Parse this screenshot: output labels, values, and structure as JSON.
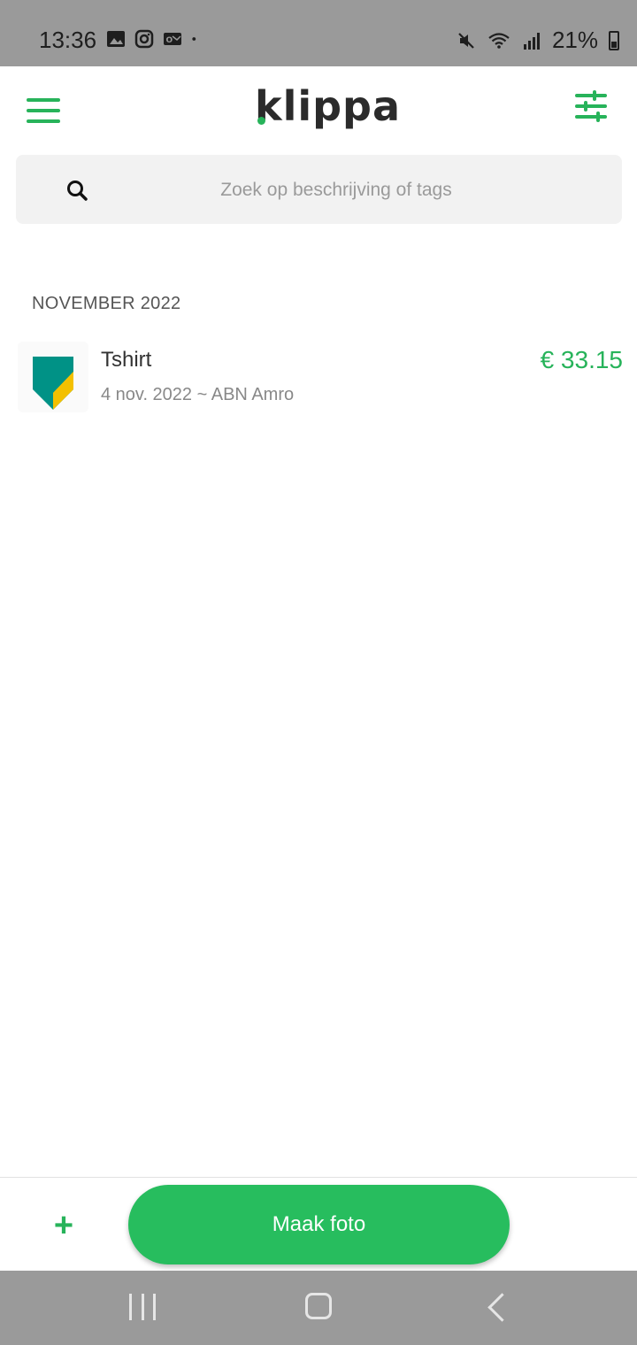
{
  "status_bar": {
    "time": "13:36",
    "battery": "21%",
    "left_icons": [
      "gallery-icon",
      "instagram-icon",
      "outlook-icon",
      "dot-icon"
    ],
    "right_icons": [
      "mute-icon",
      "wifi-icon",
      "signal-icon",
      "battery-icon"
    ]
  },
  "app_bar": {
    "logo": "klippa",
    "accent_color": "#27b35a"
  },
  "search": {
    "placeholder": "Zoek op beschrijving of tags",
    "value": ""
  },
  "list": {
    "section_header": "NOVEMBER 2022",
    "items": [
      {
        "title": "Tshirt",
        "subtitle": "4 nov. 2022 ~ ABN Amro",
        "amount": "€ 33.15",
        "logo_icon": "abn-amro-logo"
      }
    ]
  },
  "bottom_bar": {
    "add_label": "+",
    "photo_button_label": "Maak foto",
    "photo_button_color": "#27bd5e"
  }
}
